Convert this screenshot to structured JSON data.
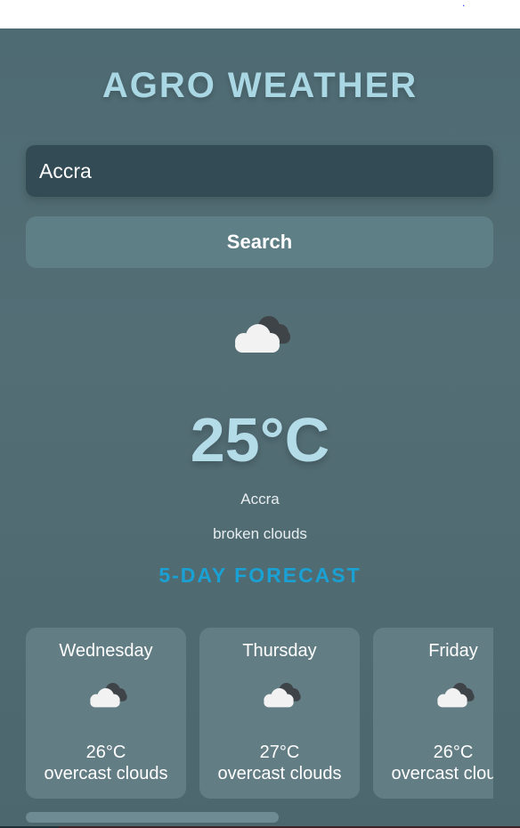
{
  "top_bar": {
    "link_dot": "."
  },
  "app": {
    "title": "AGRO WEATHER",
    "search": {
      "value": "Accra",
      "placeholder": "",
      "button_label": "Search"
    },
    "current": {
      "icon": "broken-clouds-icon",
      "temperature": "25°C",
      "city": "Accra",
      "description": "broken clouds"
    },
    "forecast_heading": "5-DAY FORECAST",
    "forecast": [
      {
        "day": "Wednesday",
        "icon": "overcast-clouds-icon",
        "temp": "26°C",
        "description": "overcast clouds"
      },
      {
        "day": "Thursday",
        "icon": "overcast-clouds-icon",
        "temp": "27°C",
        "description": "overcast clouds"
      },
      {
        "day": "Friday",
        "icon": "overcast-clouds-icon",
        "temp": "26°C",
        "description": "overcast clouds"
      }
    ],
    "forecast_scroll_fraction": 0.54
  },
  "colors": {
    "background": "#4e6a72",
    "title": "#a9d7e3",
    "accent": "#1aa1d4",
    "input": "#334b54",
    "button": "#5f7f86",
    "card": "#637d84"
  }
}
